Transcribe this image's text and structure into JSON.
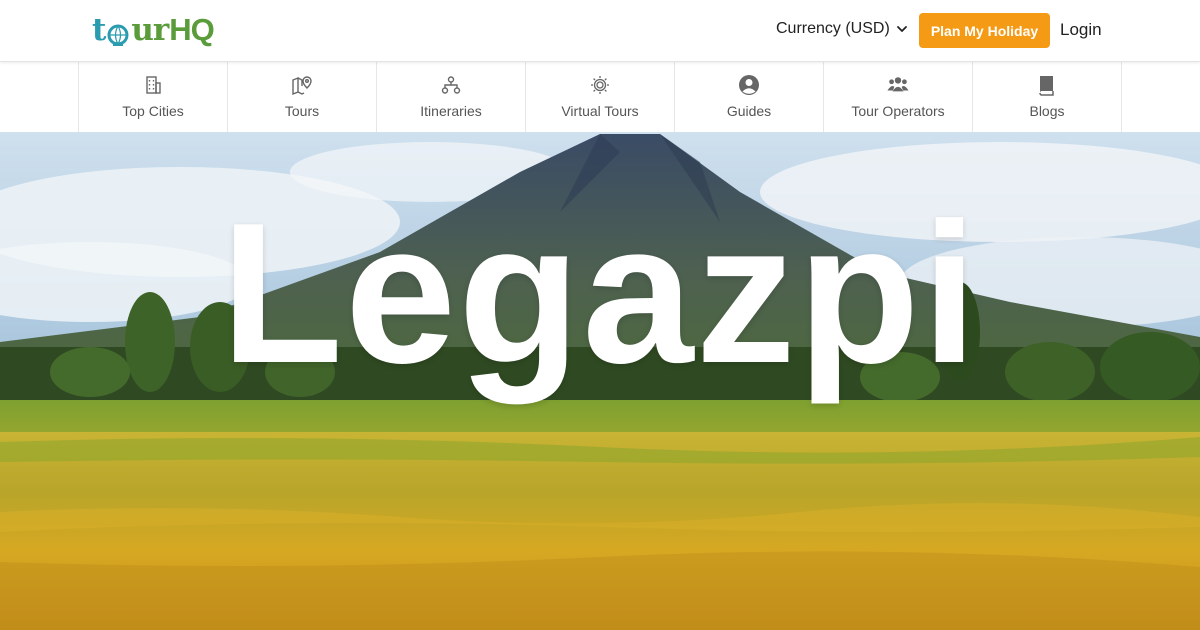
{
  "header": {
    "logo": {
      "part1": "t",
      "part2": "ur",
      "part3": "HQ"
    },
    "currency_label": "Currency (USD)",
    "plan_button": "Plan My Holiday",
    "login_label": "Login"
  },
  "nav": {
    "items": [
      {
        "label": "Top Cities",
        "icon": "building-icon"
      },
      {
        "label": "Tours",
        "icon": "map-pin-icon"
      },
      {
        "label": "Itineraries",
        "icon": "sitemap-icon"
      },
      {
        "label": "Virtual Tours",
        "icon": "vr-icon"
      },
      {
        "label": "Guides",
        "icon": "user-circle-icon"
      },
      {
        "label": "Tour Operators",
        "icon": "users-icon"
      },
      {
        "label": "Blogs",
        "icon": "book-icon"
      }
    ]
  },
  "hero": {
    "title": "Legazpi"
  },
  "colors": {
    "accent": "#f59a14",
    "logo_blue": "#2a9cb0",
    "logo_green": "#5a9b3a"
  }
}
